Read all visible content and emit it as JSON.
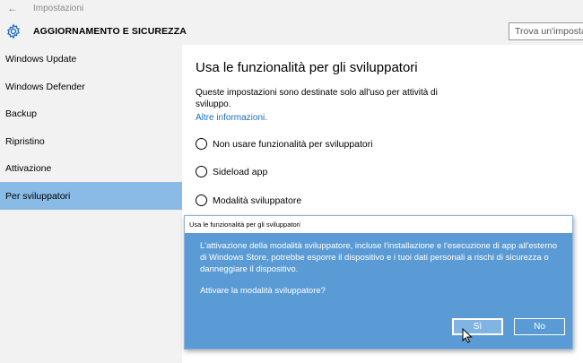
{
  "window": {
    "title": "Impostazioni",
    "back_icon": "back-arrow-icon"
  },
  "header": {
    "section_title": "AGGIORNAMENTO E SICUREZZA",
    "search_value": "Trova un'impostazione",
    "gear_icon": "gear-icon"
  },
  "sidebar": {
    "items": [
      {
        "label": "Windows Update",
        "active": false
      },
      {
        "label": "Windows Defender",
        "active": false
      },
      {
        "label": "Backup",
        "active": false
      },
      {
        "label": "Ripristino",
        "active": false
      },
      {
        "label": "Attivazione",
        "active": false
      },
      {
        "label": "Per sviluppatori",
        "active": true
      }
    ]
  },
  "main": {
    "title": "Usa le funzionalità per gli sviluppatori",
    "description": "Queste impostazioni sono destinate solo all'uso per attività di sviluppo.",
    "more_info": "Altre informazioni.",
    "options": [
      {
        "label": "Non usare funzionalità per sviluppatori"
      },
      {
        "label": "Sideload app"
      },
      {
        "label": "Modalità sviluppatore"
      }
    ]
  },
  "dialog": {
    "title": "Usa le funzionalità per gli sviluppatori",
    "message": "L'attivazione della modalità sviluppatore, incluse l'installazione e l'esecuzione di app all'esterno di Windows Store, potrebbe esporre il dispositivo e i tuoi dati personali a rischi di sicurezza o danneggiare il dispositivo.",
    "question": "Attivare la modalità sviluppatore?",
    "yes_label": "Sì",
    "no_label": "No"
  },
  "colors": {
    "active_item": "#89bbe6",
    "dialog_bg": "#5b9bd5",
    "link": "#1a6fc0"
  }
}
